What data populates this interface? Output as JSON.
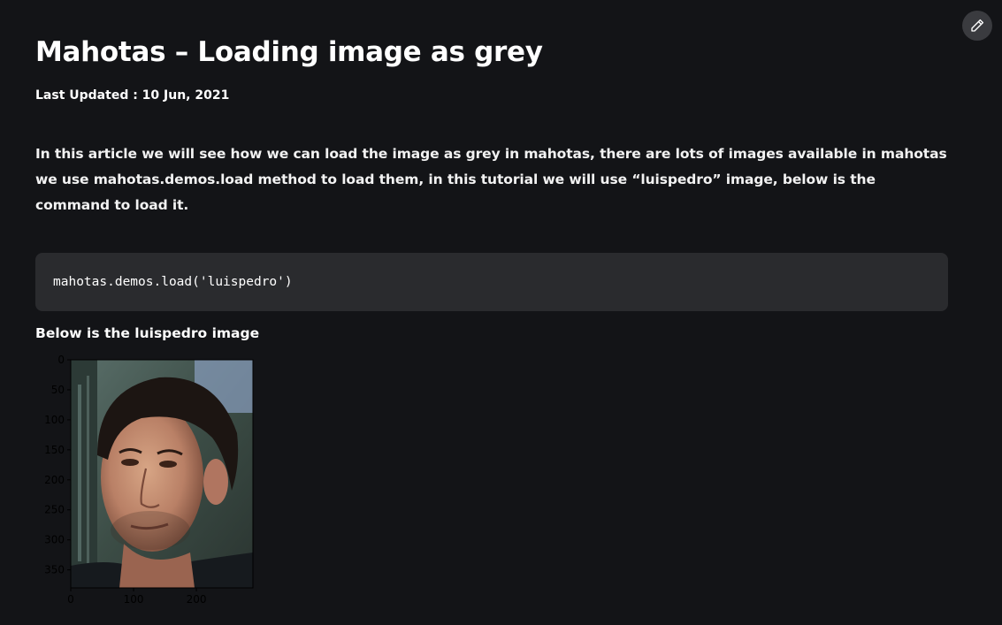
{
  "article": {
    "title": "Mahotas – Loading image as grey",
    "last_updated": "Last Updated : 10 Jun, 2021",
    "intro": "In this article we will see how we can load the image as grey in mahotas, there are lots of images available in mahotas we use mahotas.demos.load method to load them, in this tutorial we will use “luispedro” image, below is the command to load it.",
    "code": "mahotas.demos.load('luispedro')",
    "caption": "Below is the luispedro image"
  },
  "toolbar": {
    "edit_icon": "pencil-icon"
  },
  "figure": {
    "y_ticks": [
      "0",
      "50",
      "100",
      "150",
      "200",
      "250",
      "300",
      "350"
    ],
    "x_ticks": [
      "0",
      "100",
      "200"
    ]
  },
  "colors": {
    "background": "#131417",
    "code_background": "#2a2b2e",
    "edit_button": "#3a3b3f"
  }
}
